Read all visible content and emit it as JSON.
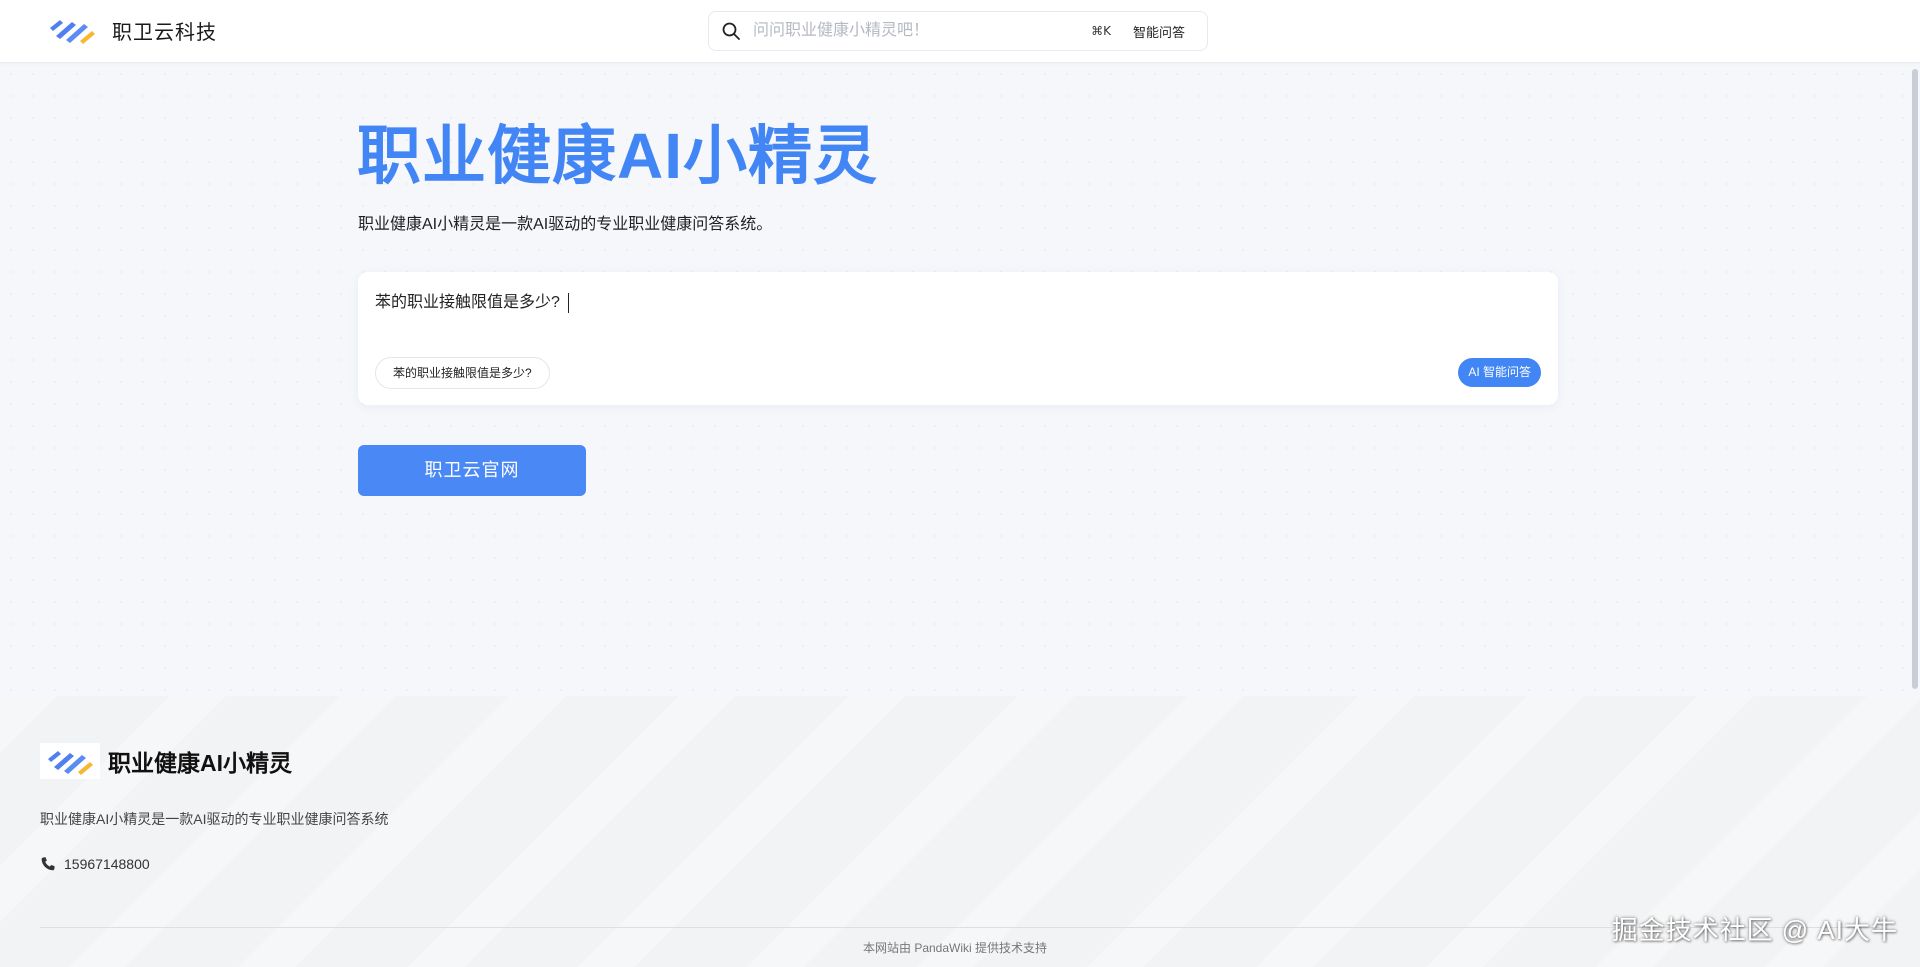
{
  "header": {
    "brand_name": "职卫云科技",
    "search": {
      "placeholder": "问问职业健康小精灵吧！",
      "shortcut": "⌘K",
      "smart_qa_label": "智能问答"
    }
  },
  "main": {
    "title": "职业健康AI小精灵",
    "description": "职业健康AI小精灵是一款AI驱动的专业职业健康问答系统。",
    "question_input": "苯的职业接触限值是多少?",
    "suggestion_chip": "苯的职业接触限值是多少?",
    "ai_button_label": "AI 智能问答",
    "official_site_button": "职卫云官网"
  },
  "footer": {
    "brand_name": "职业健康AI小精灵",
    "description": "职业健康AI小精灵是一款AI驱动的专业职业健康问答系统",
    "phone": "15967148800",
    "powered_by": "本网站由 PandaWiki 提供技术支持",
    "watermark": "掘金技术社区 @ AI大牛"
  },
  "colors": {
    "accent": "#4285f4",
    "button": "#4a88f5",
    "logo_blue": "#4f7ff0",
    "logo_yellow": "#f7b731"
  },
  "icons": [
    "logo-icon",
    "search-icon",
    "phone-icon"
  ]
}
